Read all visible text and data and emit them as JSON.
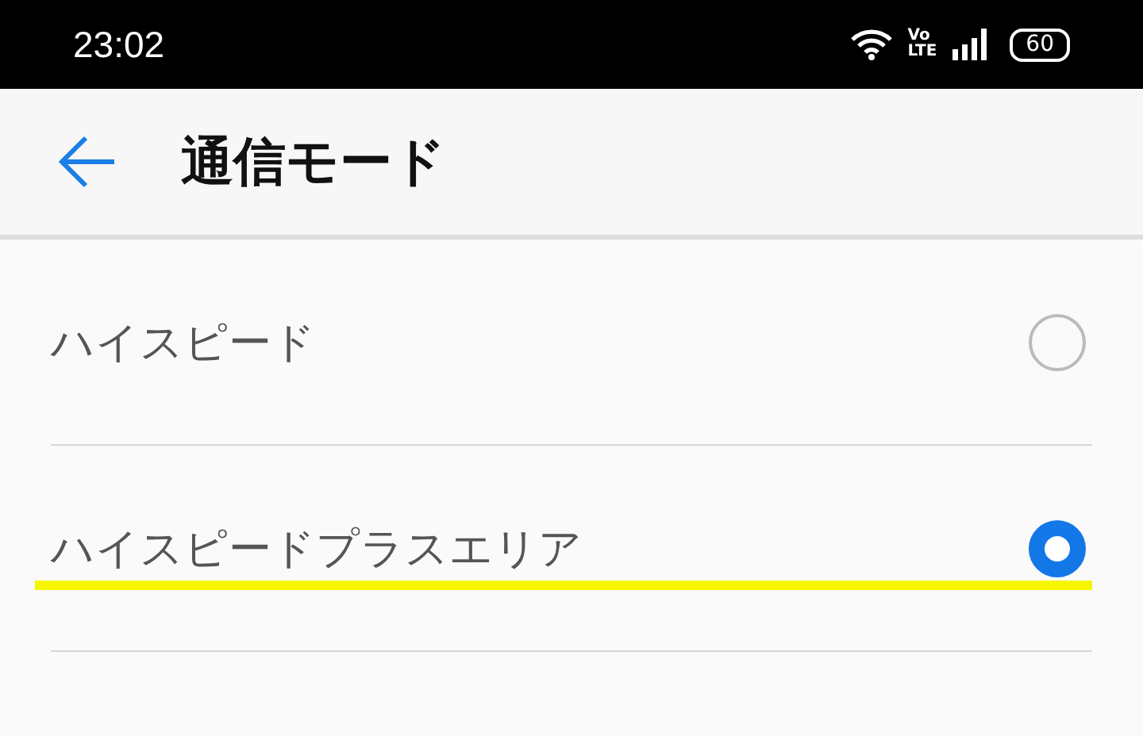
{
  "status_bar": {
    "time": "23:02",
    "network_top": "Vo",
    "network_bottom": "LTE",
    "battery": "60"
  },
  "header": {
    "title": "通信モード"
  },
  "options": [
    {
      "label": "ハイスピード",
      "selected": false,
      "highlighted": false
    },
    {
      "label": "ハイスピードプラスエリア",
      "selected": true,
      "highlighted": true
    }
  ]
}
